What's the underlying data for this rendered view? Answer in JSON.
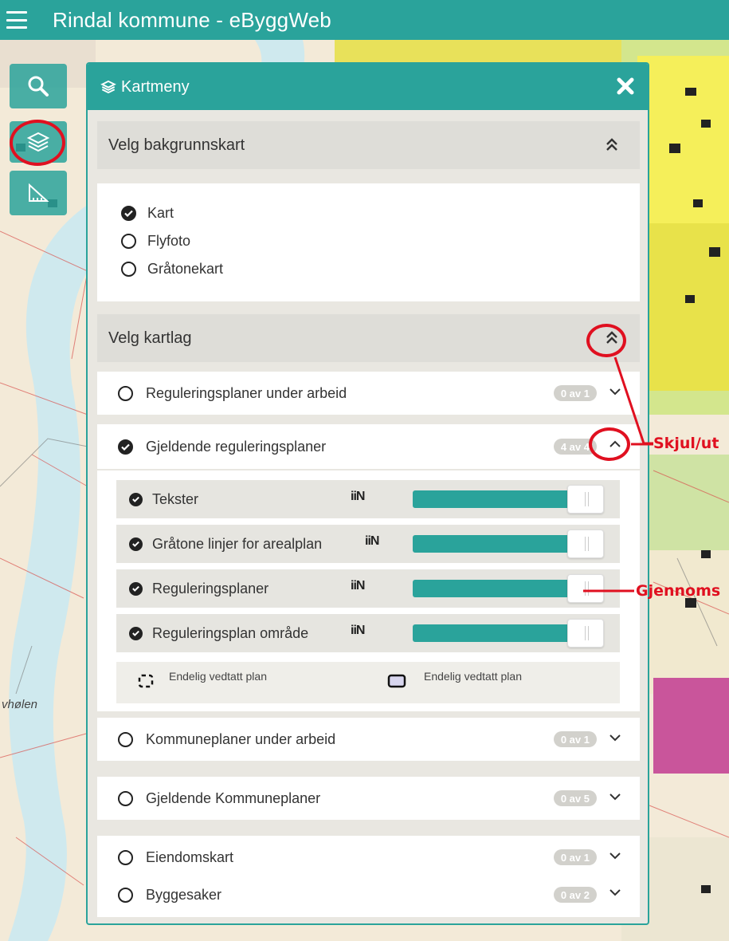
{
  "app": {
    "title": "Rindal kommune - eByggWeb"
  },
  "map": {
    "place_label": "vhølen"
  },
  "panel": {
    "title": "Kartmeny",
    "background_section": {
      "title": "Velg bakgrunnskart",
      "options": [
        {
          "label": "Kart",
          "selected": true
        },
        {
          "label": "Flyfoto",
          "selected": false
        },
        {
          "label": "Gråtonekart",
          "selected": false
        }
      ]
    },
    "layers_section": {
      "title": "Velg kartlag",
      "groups": [
        {
          "label": "Reguleringsplaner under arbeid",
          "badge": "0 av 1",
          "checked": false
        },
        {
          "label": "Gjeldende reguleringsplaner",
          "badge": "4 av 4",
          "checked": true,
          "expanded": true
        },
        {
          "label": "Kommuneplaner under arbeid",
          "badge": "0 av 1",
          "checked": false
        },
        {
          "label": "Gjeldende Kommuneplaner",
          "badge": "0 av 5",
          "checked": false
        },
        {
          "label": "Eiendomskart",
          "badge": "0 av 1",
          "checked": false
        },
        {
          "label": "Byggesaker",
          "badge": "0 av 2",
          "checked": false
        }
      ],
      "sublayers": [
        {
          "label": "Tekster",
          "legend_icon": "iiN",
          "opacity": 1.0
        },
        {
          "label": "Gråtone linjer for arealplan",
          "legend_icon": "iiN",
          "opacity": 1.0
        },
        {
          "label": "Reguleringsplaner",
          "legend_icon": "iiN",
          "opacity": 1.0
        },
        {
          "label": "Reguleringsplan område",
          "legend_icon": "iiN",
          "opacity": 1.0
        }
      ],
      "legend": [
        {
          "label": "Endelig vedtatt plan",
          "symbol": "dashed-box-icon"
        },
        {
          "label": "Endelig vedtatt plan",
          "symbol": "filled-box-icon"
        }
      ]
    }
  },
  "annotations": {
    "toggle": "Skjul/ut",
    "opacity": "Gjennoms"
  },
  "colors": {
    "accent": "#2aa39b",
    "annotation": "#e01020",
    "badge": "#d2d1cc"
  }
}
